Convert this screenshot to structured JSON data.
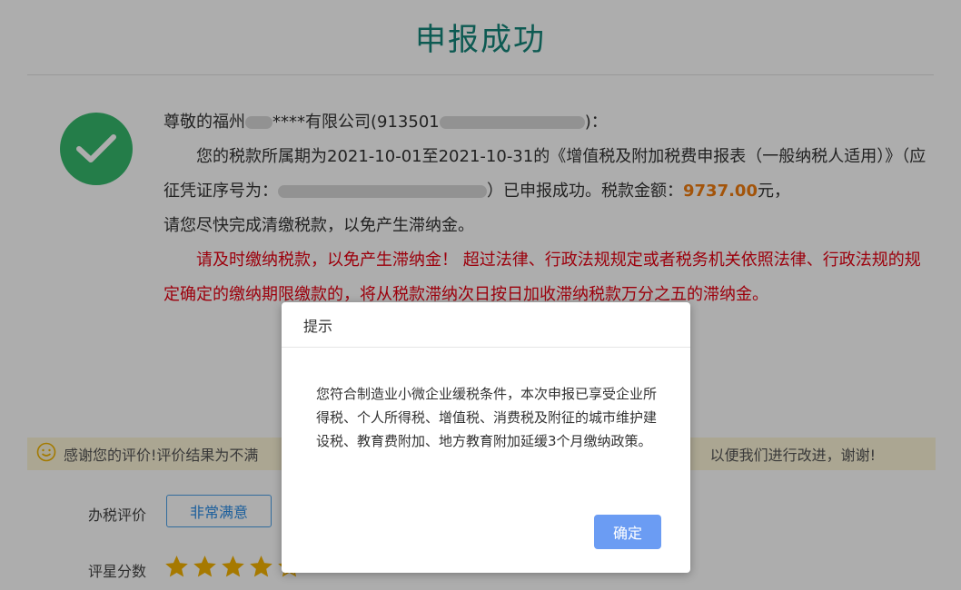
{
  "page": {
    "title": "申报成功",
    "message": {
      "greeting_prefix": "尊敬的福州",
      "greeting_mid": "****有限公司(913501",
      "greeting_suffix": ")：",
      "line1_prefix": "您的税款所属期为2021-10-01至2021-10-31的《增值税及附加税费申报表（一般纳税人适用）》（应征凭证序号为：",
      "line1_suffix": "）已申报成功。税款金额：",
      "amount": "9737.00",
      "amount_unit": "元，",
      "line2": "请您尽快完成清缴税款，以免产生滞纳金。",
      "warning": "请及时缴纳税款，以免产生滞纳金！ 超过法律、行政法规规定或者税务机关依照法律、行政法规的规定确定的缴纳期限缴款的，将从税款滞纳次日按日加收滞纳税款万分之五的滞纳金。"
    },
    "feedback": {
      "text": "感谢您的评价!评价结果为不满",
      "tail": "以便我们进行改进，谢谢!"
    },
    "evaluation": {
      "label": "办税评价",
      "option": "非常满意"
    },
    "rating": {
      "label": "评星分数",
      "stars_filled": 4
    }
  },
  "modal": {
    "title": "提示",
    "body": "您符合制造业小微企业缓税条件，本次申报已享受企业所得税、个人所得税、增值税、消费税及附征的城市维护建设税、教育费附加、地方教育附加延缓3个月缴纳政策。",
    "ok_label": "确定"
  },
  "colors": {
    "title": "#14857a",
    "check": "#35b86c",
    "amount": "#f07d0f",
    "warning": "#e60012",
    "ok_button": "#6b9cf3",
    "star": "#f5b301"
  }
}
